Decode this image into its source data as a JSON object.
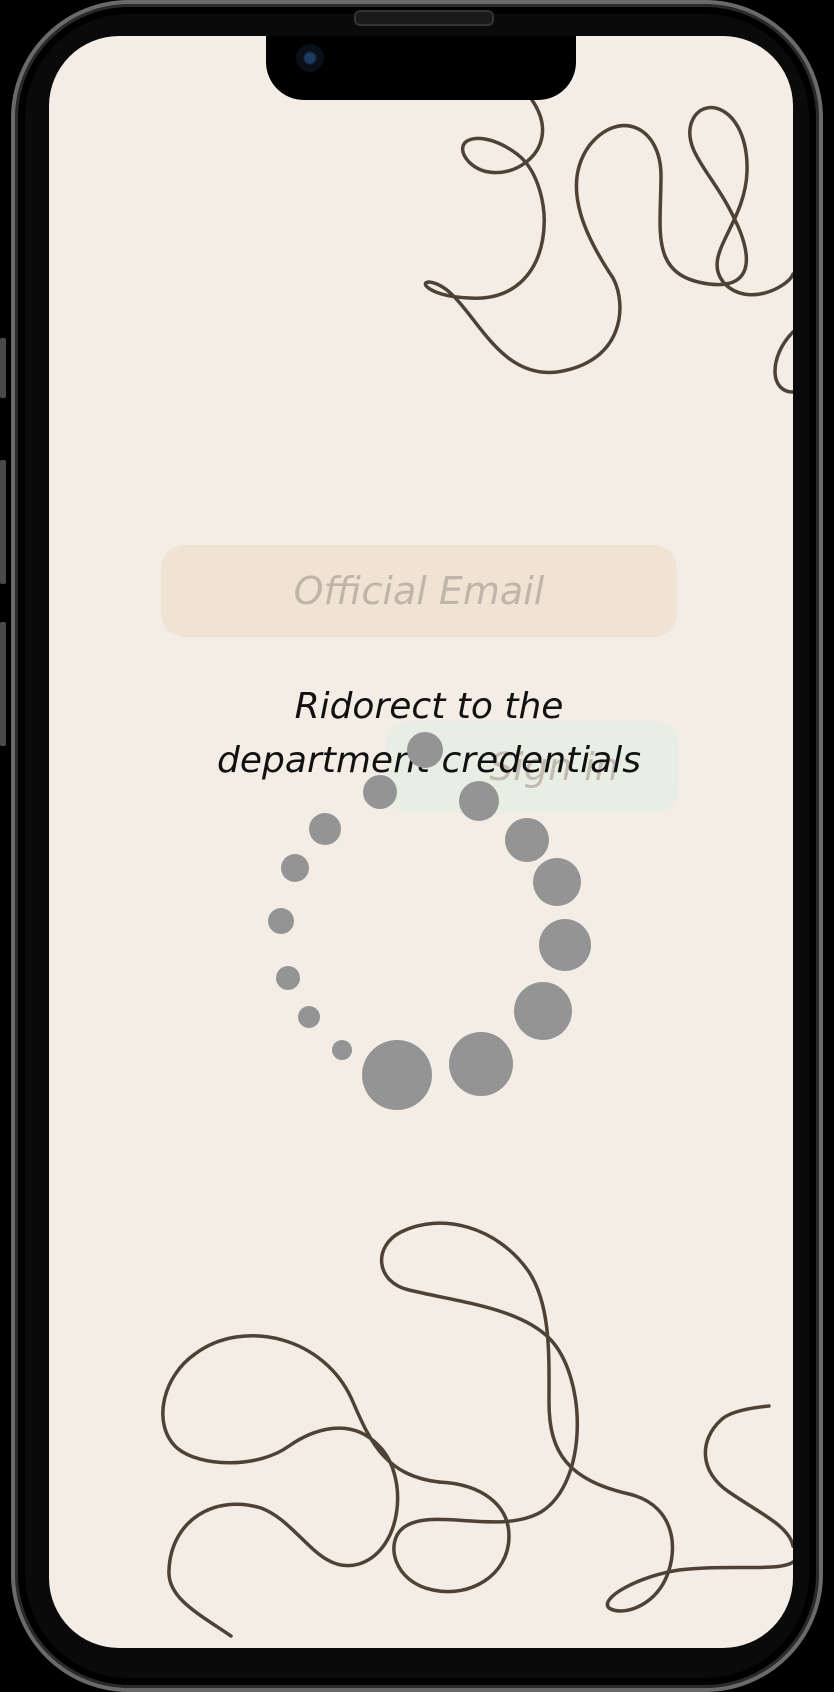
{
  "login": {
    "email_placeholder": "Official Email",
    "signin_label": "Sign in"
  },
  "overlay": {
    "redirect_message": "Ridorect to the department credentials"
  },
  "colors": {
    "background": "#f3ede6",
    "squiggle": "#4e4236",
    "spinner_dot": "#949494",
    "email_field": "#f0e3d4",
    "signin_button": "#e9eee4"
  },
  "icons": {
    "loading": "loading-spinner-icon"
  }
}
